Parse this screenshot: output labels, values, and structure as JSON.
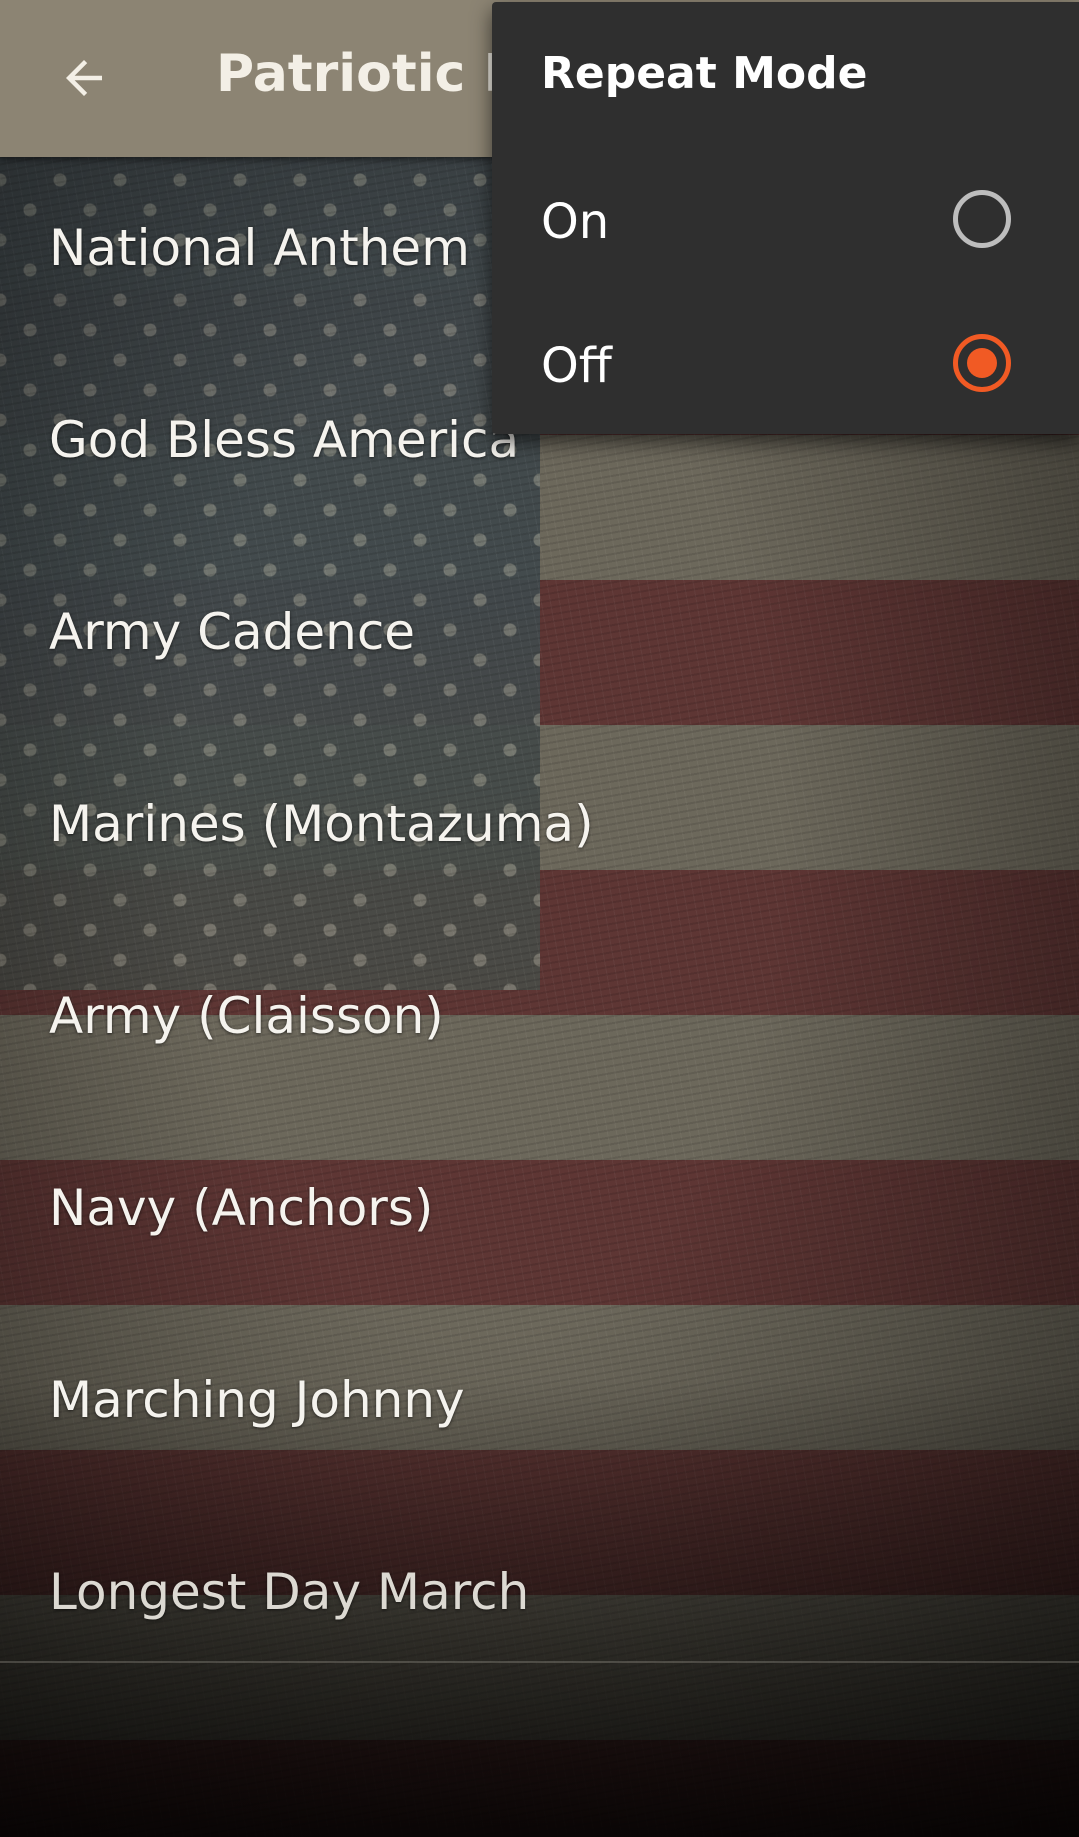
{
  "app_bar": {
    "title": "Patriotic R",
    "back_icon": "arrow-left-icon",
    "background_color": "#8c8473"
  },
  "songs": [
    {
      "label": "National Anthem"
    },
    {
      "label": "God Bless America"
    },
    {
      "label": "Army Cadence"
    },
    {
      "label": "Marines (Montazuma)"
    },
    {
      "label": "Army (Claisson)"
    },
    {
      "label": "Navy (Anchors)"
    },
    {
      "label": "Marching Johnny"
    },
    {
      "label": "Longest Day March"
    }
  ],
  "repeat_menu": {
    "title": "Repeat Mode",
    "options": [
      {
        "label": "On",
        "selected": false
      },
      {
        "label": "Off",
        "selected": true
      }
    ],
    "accent_color": "#f15a24",
    "background_color": "#2f2f2f"
  }
}
